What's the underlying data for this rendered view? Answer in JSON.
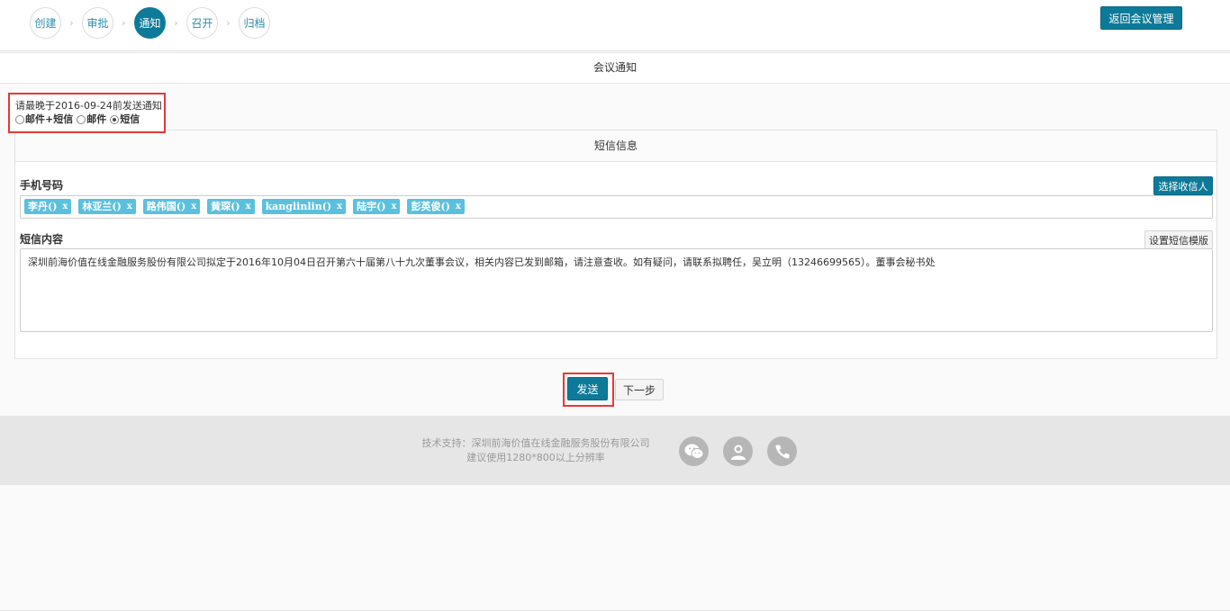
{
  "steps": [
    {
      "label": "创建",
      "active": false
    },
    {
      "label": "审批",
      "active": false
    },
    {
      "label": "通知",
      "active": true
    },
    {
      "label": "召开",
      "active": false
    },
    {
      "label": "归档",
      "active": false
    }
  ],
  "step_separator": "›",
  "header": {
    "back_button": "返回会议管理"
  },
  "notice": {
    "section_title": "会议通知",
    "deadline_text": "请最晚于2016-09-24前发送通知",
    "options": [
      {
        "label": "邮件+短信",
        "checked": false
      },
      {
        "label": "邮件",
        "checked": false
      },
      {
        "label": "短信",
        "checked": true
      }
    ]
  },
  "sms": {
    "section_title": "短信信息",
    "phone_label": "手机号码",
    "select_recipients_button": "选择收信人",
    "recipients": [
      "李丹()",
      "林亚兰()",
      "路伟国()",
      "黄琛()",
      "kanglinlin()",
      "陆宇()",
      "彭英俊()"
    ],
    "remove_glyph": "x",
    "content_label": "短信内容",
    "template_button": "设置短信模版",
    "content": "深圳前海价值在线金融服务股份有限公司拟定于2016年10月04日召开第六十届第八十九次董事会议，相关内容已发到邮箱，请注意查收。如有疑问，请联系拟聘任，吴立明（13246699565）。董事会秘书处"
  },
  "actions": {
    "send": "发送",
    "next": "下一步"
  },
  "footer": {
    "line1": "技术支持：深圳前海价值在线金融服务股份有限公司",
    "line2": "建议使用1280*800以上分辨率",
    "icons": [
      "wechat-icon",
      "user-support-icon",
      "phone-icon"
    ]
  },
  "colors": {
    "primary": "#0e7a99",
    "tag": "#5bc0de",
    "highlight": "#e53935"
  }
}
